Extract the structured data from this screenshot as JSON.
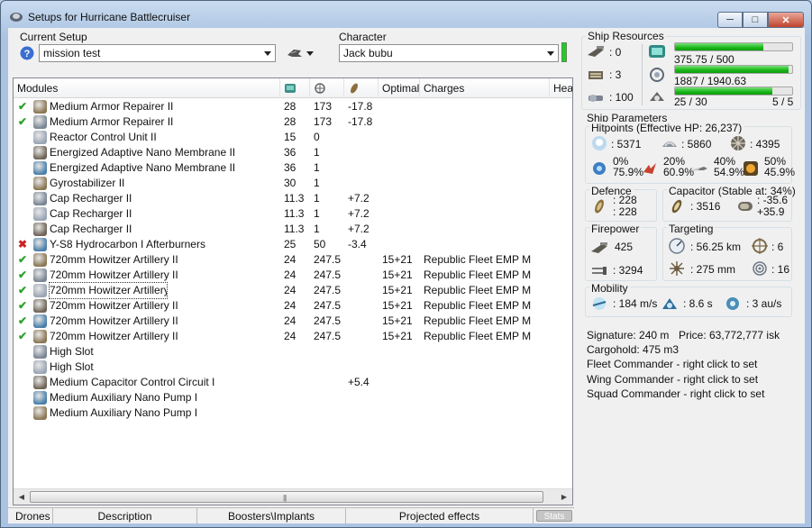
{
  "window": {
    "title": "Setups for Hurricane Battlecruiser"
  },
  "setup": {
    "label": "Current Setup",
    "value": "mission test"
  },
  "character": {
    "label": "Character",
    "value": "Jack bubu"
  },
  "modules_table": {
    "columns": [
      "Modules",
      "",
      "",
      "",
      "Optimal",
      "Charges",
      "Hea"
    ],
    "rows": [
      {
        "status": "ok",
        "name": "Medium Armor Repairer II",
        "cpu": "28",
        "pg": "173",
        "cap": "-17.8",
        "optimal": "",
        "charges": ""
      },
      {
        "status": "ok",
        "name": "Medium Armor Repairer II",
        "cpu": "28",
        "pg": "173",
        "cap": "-17.8",
        "optimal": "",
        "charges": ""
      },
      {
        "status": "",
        "name": "Reactor Control Unit II",
        "cpu": "15",
        "pg": "0",
        "cap": "",
        "optimal": "",
        "charges": ""
      },
      {
        "status": "",
        "name": "Energized Adaptive Nano Membrane II",
        "cpu": "36",
        "pg": "1",
        "cap": "",
        "optimal": "",
        "charges": ""
      },
      {
        "status": "",
        "name": "Energized Adaptive Nano Membrane II",
        "cpu": "36",
        "pg": "1",
        "cap": "",
        "optimal": "",
        "charges": ""
      },
      {
        "status": "",
        "name": "Gyrostabilizer II",
        "cpu": "30",
        "pg": "1",
        "cap": "",
        "optimal": "",
        "charges": ""
      },
      {
        "status": "",
        "name": "Cap Recharger II",
        "cpu": "11.3",
        "pg": "1",
        "cap": "+7.2",
        "optimal": "",
        "charges": ""
      },
      {
        "status": "",
        "name": "Cap Recharger II",
        "cpu": "11.3",
        "pg": "1",
        "cap": "+7.2",
        "optimal": "",
        "charges": ""
      },
      {
        "status": "",
        "name": "Cap Recharger II",
        "cpu": "11.3",
        "pg": "1",
        "cap": "+7.2",
        "optimal": "",
        "charges": ""
      },
      {
        "status": "bad",
        "name": "Y-S8 Hydrocarbon I Afterburners",
        "cpu": "25",
        "pg": "50",
        "cap": "-3.4",
        "optimal": "",
        "charges": ""
      },
      {
        "status": "ok",
        "name": "720mm Howitzer Artillery II",
        "cpu": "24",
        "pg": "247.5",
        "cap": "",
        "optimal": "15+21",
        "charges": "Republic Fleet EMP M"
      },
      {
        "status": "ok",
        "name": "720mm Howitzer Artillery II",
        "cpu": "24",
        "pg": "247.5",
        "cap": "",
        "optimal": "15+21",
        "charges": "Republic Fleet EMP M"
      },
      {
        "status": "ok",
        "name": "720mm Howitzer Artillery II",
        "cpu": "24",
        "pg": "247.5",
        "cap": "",
        "optimal": "15+21",
        "charges": "Republic Fleet EMP M"
      },
      {
        "status": "ok",
        "name": "720mm Howitzer Artillery II",
        "cpu": "24",
        "pg": "247.5",
        "cap": "",
        "optimal": "15+21",
        "charges": "Republic Fleet EMP M"
      },
      {
        "status": "ok",
        "name": "720mm Howitzer Artillery II",
        "cpu": "24",
        "pg": "247.5",
        "cap": "",
        "optimal": "15+21",
        "charges": "Republic Fleet EMP M"
      },
      {
        "status": "ok",
        "name": "720mm Howitzer Artillery II",
        "cpu": "24",
        "pg": "247.5",
        "cap": "",
        "optimal": "15+21",
        "charges": "Republic Fleet EMP M"
      },
      {
        "status": "",
        "name": "High Slot",
        "cpu": "",
        "pg": "",
        "cap": "",
        "optimal": "",
        "charges": ""
      },
      {
        "status": "",
        "name": "High Slot",
        "cpu": "",
        "pg": "",
        "cap": "",
        "optimal": "",
        "charges": ""
      },
      {
        "status": "",
        "name": "Medium Capacitor Control Circuit I",
        "cpu": "",
        "pg": "",
        "cap": "+5.4",
        "optimal": "",
        "charges": ""
      },
      {
        "status": "",
        "name": "Medium Auxiliary Nano Pump I",
        "cpu": "",
        "pg": "",
        "cap": "",
        "optimal": "",
        "charges": ""
      },
      {
        "status": "",
        "name": "Medium Auxiliary Nano Pump I",
        "cpu": "",
        "pg": "",
        "cap": "",
        "optimal": "",
        "charges": ""
      }
    ]
  },
  "tabs": [
    "Drones",
    "Description",
    "Boosters\\Implants",
    "Projected effects",
    "Stats"
  ],
  "resources": {
    "label": "Ship Resources",
    "turret_slots": ": 0",
    "launcher_slots": ": 3",
    "calibration": ": 100",
    "cpu_text": "375.75 / 500",
    "cpu_fraction": 0.75,
    "pg_text": "1887 / 1940.63",
    "pg_fraction": 0.97,
    "bandwidth_text": "25 / 30",
    "bandwidth_fraction": 0.83,
    "drones_text": "5 / 5"
  },
  "parameters": {
    "label": "Ship Parameters",
    "hitpoints_label": "Hitpoints (Effective HP: 26,237)",
    "shield_hp": ": 5371",
    "armor_hp": ": 5860",
    "structure_hp": ": 4395",
    "res_em": "0%",
    "res_em2": "75.9%",
    "res_th": "20%",
    "res_th2": "60.9%",
    "res_ki": "40%",
    "res_ki2": "54.9%",
    "res_ex": "50%",
    "res_ex2": "45.9%",
    "defence_label": "Defence",
    "defence_1": ": 228",
    "defence_2": ": 228",
    "capacitor_label": "Capacitor (Stable at: 34%)",
    "cap_capacity": ": 3516",
    "cap_delta_1": ": -35.6",
    "cap_delta_2": "+35.9",
    "firepower_label": "Firepower",
    "firepower_1": "425",
    "firepower_2": ": 3294",
    "targeting_label": "Targeting",
    "target_range": ": 56.25 km",
    "max_targets": ": 6",
    "scan_res": ": 275 mm",
    "sensor_strength": ": 16",
    "mobility_label": "Mobility",
    "velocity": ": 184 m/s",
    "align_time": ": 8.6 s",
    "warp_speed": ": 3 au/s",
    "signature": "Signature: 240 m",
    "price": "Price: 63,772,777 isk",
    "cargohold": "Cargohold: 475 m3",
    "fleet_commander": "Fleet Commander - right click to set",
    "wing_commander": "Wing Commander - right click to set",
    "squad_commander": "Squad Commander - right click to set"
  }
}
